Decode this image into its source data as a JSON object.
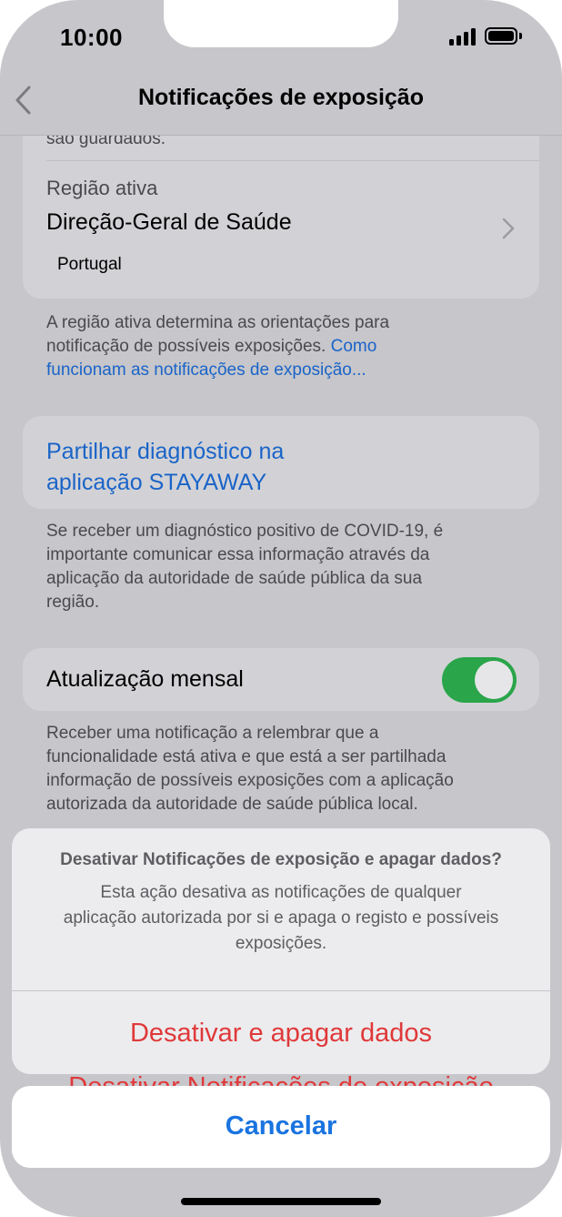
{
  "status_bar": {
    "time": "10:00"
  },
  "nav": {
    "title": "Notificações de exposição"
  },
  "content": {
    "truncated_text": "são guardados.",
    "region": {
      "label": "Região ativa",
      "authority": "Direção-Geral de Saúde",
      "country": "Portugal"
    },
    "region_footer": {
      "text_line1": "A região ativa determina as orientações para",
      "text_line2": "notificação de possíveis exposições.",
      "link_part1": "Como",
      "link_part2": "funcionam as notificações de exposição..."
    },
    "share": {
      "line1": "Partilhar diagnóstico na",
      "line2": "aplicação STAYAWAY"
    },
    "share_footer": [
      "Se receber um diagnóstico positivo de COVID-19, é",
      "importante comunicar essa informação através da",
      "aplicação da autoridade de saúde pública da sua",
      "região."
    ],
    "monthly": {
      "label": "Atualização mensal",
      "enabled": true,
      "toggle_color": "#2aa54a"
    },
    "monthly_footer": [
      "Receber uma notificação a relembrar que a",
      "funcionalidade está ativa e que está a ser partilhada",
      "informação de possíveis exposições com a aplicação",
      "autorizada da autoridade de saúde pública local."
    ]
  },
  "action_sheet": {
    "title": "Desativar Notificações de exposição e apagar dados?",
    "message_lines": [
      "Esta ação desativa as notificações de qualquer",
      "aplicação autorizada por si e apaga o registo e possíveis",
      "exposições."
    ],
    "destructive_label": "Desativar e apagar dados",
    "behind_label": "Desativar Notificações de exposição",
    "cancel_label": "Cancelar",
    "destructive_color": "#e0393a",
    "cancel_color": "#1a74e0"
  }
}
